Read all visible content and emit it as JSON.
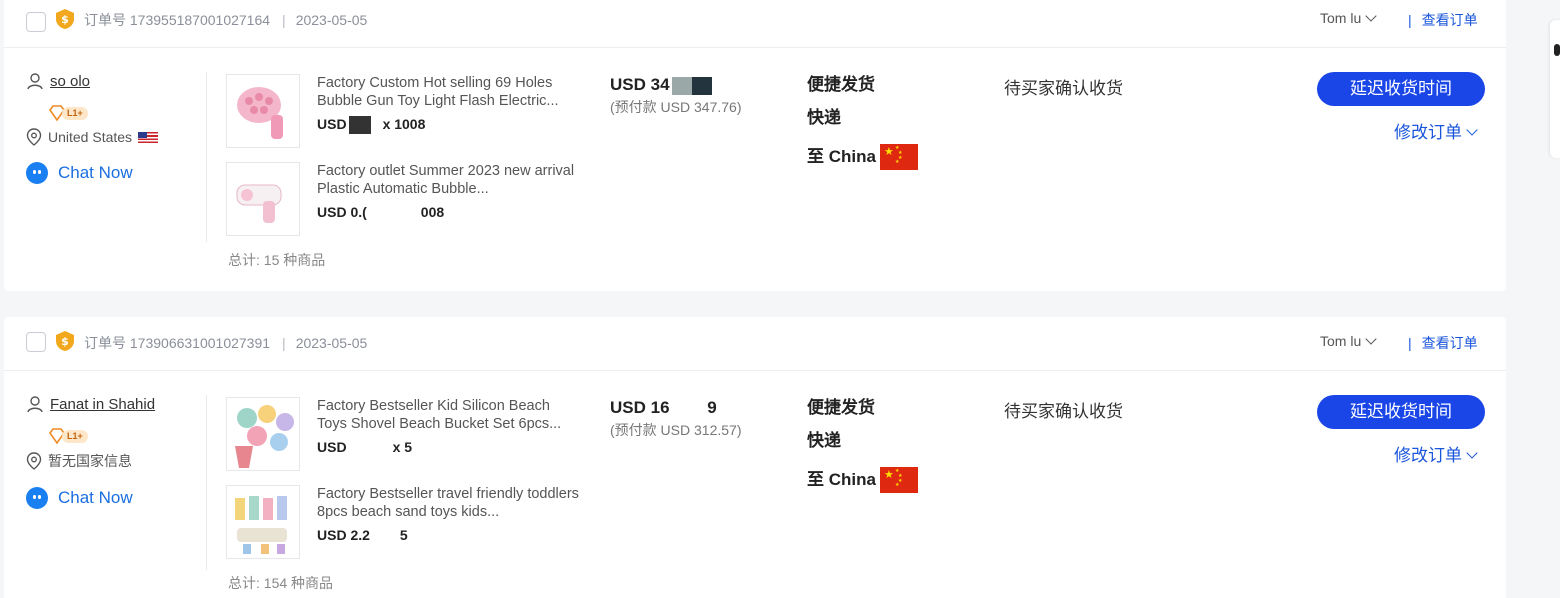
{
  "orders": [
    {
      "order_label": "订单号 173955187001027164",
      "date": "2023-05-05",
      "assignee": "Tom lu",
      "view_order": "查看订单",
      "buyer": {
        "name": "so        olo",
        "level": "L1+",
        "country": "United States"
      },
      "chat_label": "Chat Now",
      "products": [
        {
          "title": "Factory Custom Hot selling 69 Holes Bubble Gun Toy Light Flash Electric...",
          "price": "USD",
          "qty": "x 1008"
        },
        {
          "title": "Factory outlet Summer 2023 new arrival Plastic Automatic Bubble...",
          "price": "USD 0.(",
          "qty": "008"
        }
      ],
      "total_items": "总计: 15 种商品",
      "amount_main": "USD 34",
      "amount_prepay": "(预付款 USD 347.76)",
      "shipping_method": "便捷发货",
      "shipping_type": "快递",
      "destination": "至 China",
      "status": "待买家确认收货",
      "primary_action": "延迟收货时间",
      "secondary_action": "修改订单"
    },
    {
      "order_label": "订单号 173906631001027391",
      "date": "2023-05-05",
      "assignee": "Tom lu",
      "view_order": "查看订单",
      "buyer": {
        "name": "Fanat     in Shahid",
        "level": "L1+",
        "country": "暂无国家信息"
      },
      "chat_label": "Chat Now",
      "products": [
        {
          "title": "Factory Bestseller Kid Silicon Beach Toys Shovel Beach Bucket Set 6pcs...",
          "price": "USD",
          "qty": "x 5"
        },
        {
          "title": "Factory Bestseller travel friendly toddlers 8pcs beach sand toys kids...",
          "price": "USD 2.2",
          "qty": "5"
        }
      ],
      "total_items": "总计: 154 种商品",
      "amount_main": "USD 16        9",
      "amount_prepay": "(预付款 USD 312.57)",
      "shipping_method": "便捷发货",
      "shipping_type": "快递",
      "destination": "至 China",
      "status": "待买家确认收货",
      "primary_action": "延迟收货时间",
      "secondary_action": "修改订单"
    }
  ],
  "colors": {
    "accent": "#1a46e8",
    "link": "#1a56db",
    "chat": "#1a7ff0"
  }
}
